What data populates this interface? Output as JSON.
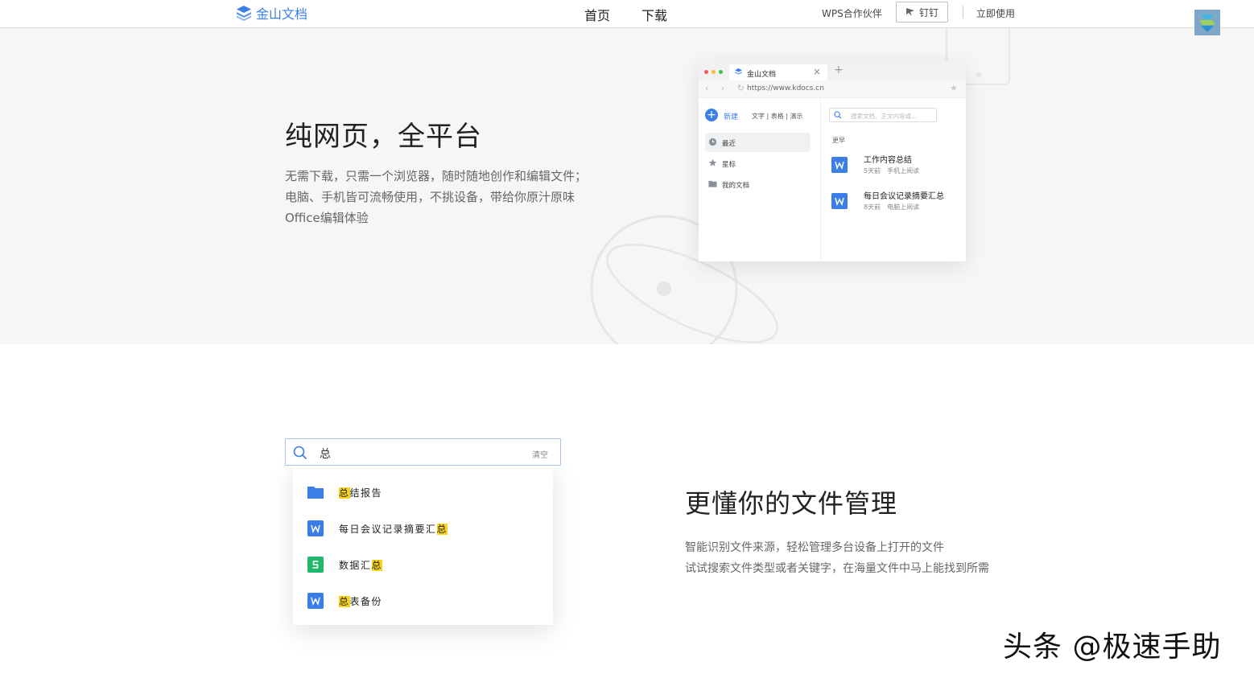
{
  "header": {
    "logo_text": "金山文档",
    "nav": [
      "首页",
      "下载"
    ],
    "partner": "WPS合作伙伴",
    "dingding": "钉钉",
    "use_now": "立即使用"
  },
  "section1": {
    "title": "纯网页，全平台",
    "desc_lines": [
      "无需下载，只需一个浏览器，随时随地创作和编辑文件；",
      "电脑、手机皆可流畅使用，不挑设备，带给你原汁原味",
      "Office编辑体验"
    ],
    "browser": {
      "tab_title": "金山文档",
      "url": "https://www.kdocs.cn",
      "new_label": "新建",
      "new_types": "文字 | 表格 | 演示",
      "sidebar": [
        "最近",
        "星标",
        "我的文档"
      ],
      "search_placeholder": "搜索文档、正文内容或…",
      "group_label": "更早",
      "docs": [
        {
          "title": "工作内容总结",
          "meta": "5天前　手机上阅读"
        },
        {
          "title": "每日会议记录摘要汇总",
          "meta": "8天前　电脑上阅读"
        }
      ]
    }
  },
  "section2": {
    "search_query": "总",
    "clear_label": "清空",
    "results": [
      {
        "icon": "folder-icon",
        "before": "",
        "hl": "总",
        "after": "结报告"
      },
      {
        "icon": "word-doc-icon",
        "before": "每日会议记录摘要汇",
        "hl": "总",
        "after": ""
      },
      {
        "icon": "sheet-doc-icon",
        "before": "数据汇",
        "hl": "总",
        "after": ""
      },
      {
        "icon": "word-doc-icon",
        "before": "",
        "hl": "总",
        "after": "表备份"
      }
    ],
    "title": "更懂你的文件管理",
    "desc_lines": [
      "智能识别文件来源，轻松管理多台设备上打开的文件",
      "试试搜索文件类型或者关键字，在海量文件中马上能找到所需"
    ]
  },
  "watermark": "头条 @极速手助",
  "colors": {
    "accent": "#3b7ee8",
    "highlight": "#f7d417",
    "sheet_green": "#1fb76b",
    "section_bg": "#f6f6f7"
  }
}
